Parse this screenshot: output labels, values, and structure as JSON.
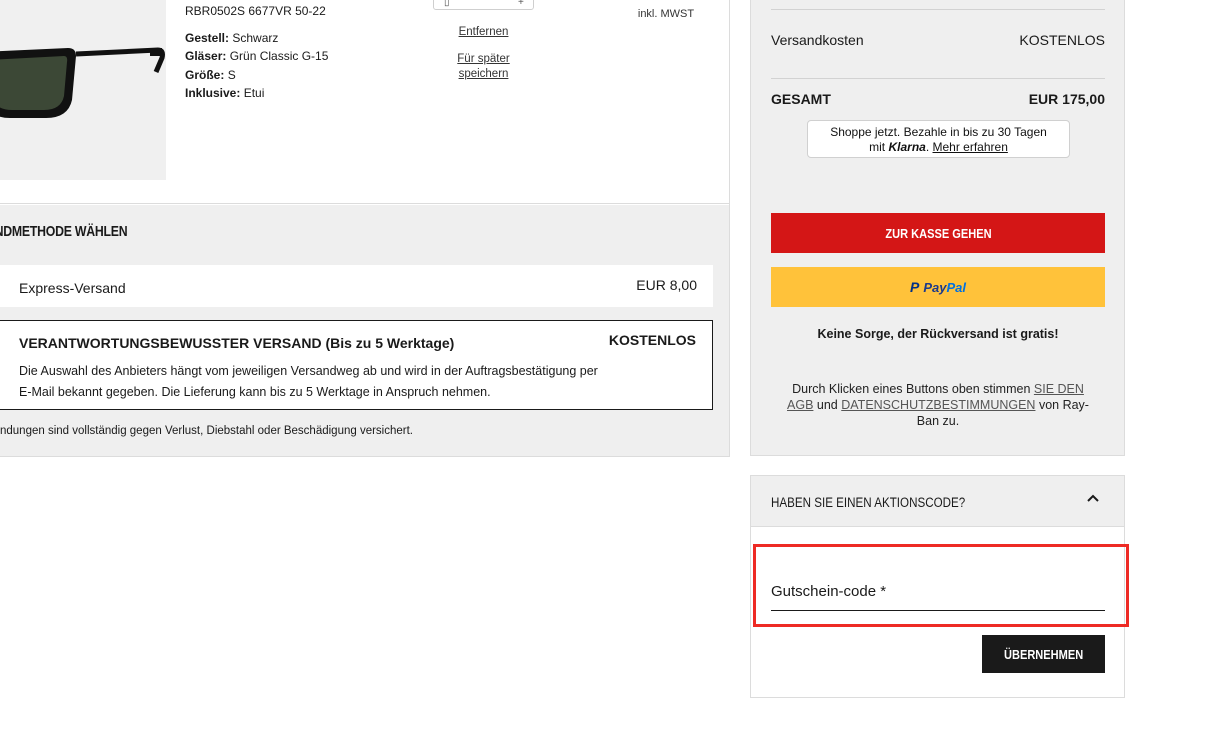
{
  "product": {
    "sku": "RBR0502S 6677VR 50-22",
    "attributes": [
      {
        "label": "Gestell:",
        "value": "Schwarz"
      },
      {
        "label": "Gläser:",
        "value": "Grün Classic G-15"
      },
      {
        "label": "Größe:",
        "value": "S"
      },
      {
        "label": "Inklusive:",
        "value": "Etui"
      }
    ],
    "remove_label": "Entfernen",
    "save_later_label": "Für später speichern",
    "tax_note": "inkl. MWST"
  },
  "shipping": {
    "title": "ANDMETHODE WÄHLEN",
    "options": [
      {
        "name": "Express-Versand",
        "price": "EUR 8,00"
      },
      {
        "name": "VERANTWORTUNGSBEWUSSTER VERSAND (Bis zu 5 Werktage)",
        "price": "KOSTENLOS",
        "description": "Die Auswahl des Anbieters hängt vom jeweiligen Versandweg ab und wird in der Auftragsbestätigung per E-Mail bekannt gegeben. Die Lieferung kann bis zu 5 Werktage in Anspruch nehmen."
      }
    ],
    "note": "ndungen sind vollständig gegen Verlust, Diebstahl oder Beschädigung versichert."
  },
  "summary": {
    "shipping_label": "Versandkosten",
    "shipping_value": "KOSTENLOS",
    "total_label": "GESAMT",
    "total_value": "EUR 175,00",
    "klarna_line1": "Shoppe jetzt. Bezahle in bis zu 30 Tagen",
    "klarna_mit": "mit",
    "klarna_brand": "Klarna",
    "klarna_link": "Mehr erfahren",
    "checkout_label": "ZUR KASSE GEHEN",
    "paypal_label_1": "Pay",
    "paypal_label_2": "Pal",
    "return_note": "Keine Sorge, der Rückversand ist gratis!",
    "terms_prefix": "Durch Klicken eines Buttons oben stimmen",
    "terms_link1": "SIE DEN AGB",
    "terms_and": "und",
    "terms_link2": "DATENSCHUTZBESTIMMUNGEN",
    "terms_suffix": "von Ray-Ban zu."
  },
  "coupon": {
    "title": "HABEN SIE EINEN AKTIONSCODE?",
    "placeholder": "Gutschein-code *",
    "apply_label": "ÜBERNEHMEN"
  }
}
